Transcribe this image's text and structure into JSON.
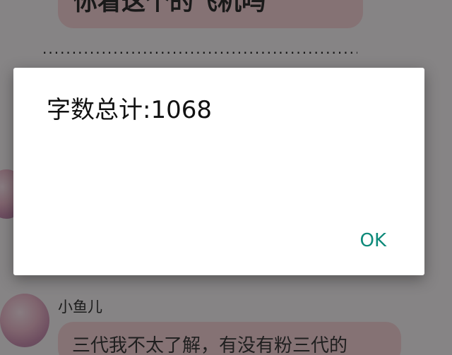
{
  "background": {
    "top_bubble_text": "你看这个的飞机吗",
    "separator_dots": "..............................................................",
    "sender_name": "小鱼儿",
    "bottom_bubble_text": "三代我不太了解，有没有粉三代的"
  },
  "dialog": {
    "message": "字数总计:1068",
    "ok_label": "OK"
  },
  "colors": {
    "accent": "#0e8a7a",
    "bubble": "#f3cfd4"
  }
}
